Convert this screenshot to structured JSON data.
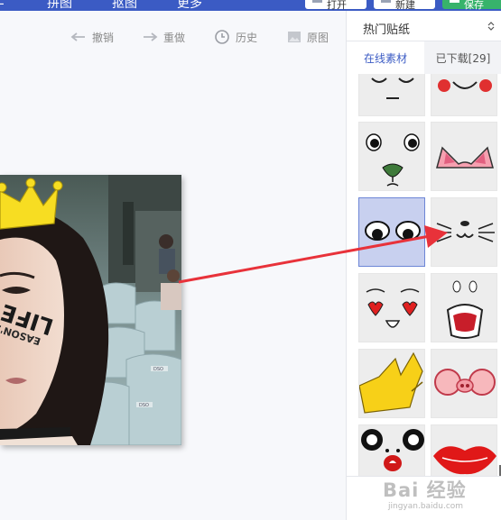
{
  "topbar": {
    "nav": [
      "拼图",
      "抠图",
      "更多"
    ],
    "buttons": [
      "打开",
      "新建",
      "保存"
    ]
  },
  "toolbar": {
    "undo": "撤销",
    "redo": "重做",
    "history": "历史",
    "original": "原图"
  },
  "photo": {
    "cheek_text_line1": "EASON'S",
    "cheek_text_line2": "LIFE",
    "seat_labels": [
      "DSO",
      "DSO"
    ]
  },
  "sidebar": {
    "category": "热门贴纸",
    "tabs": [
      "在线素材",
      "已下载[29]"
    ],
    "stickers": [
      "sleepy-face-sticker",
      "blush-smile-sticker",
      "bear-face-sticker",
      "cat-ears-sticker",
      "big-eyes-sticker",
      "cat-whiskers-sticker",
      "hearts-face-sticker",
      "bunny-mouth-sticker",
      "gold-crown-sticker",
      "pig-nose-glasses-sticker",
      "cartoon-eyes-sticker",
      "red-lips-sticker"
    ]
  },
  "watermark": {
    "mark": "Bai 经验",
    "url": "jingyan.baidu.com"
  },
  "colors": {
    "accent": "#3b5bc4",
    "arrow": "#e8323a",
    "selected": "#c8d0ef"
  }
}
